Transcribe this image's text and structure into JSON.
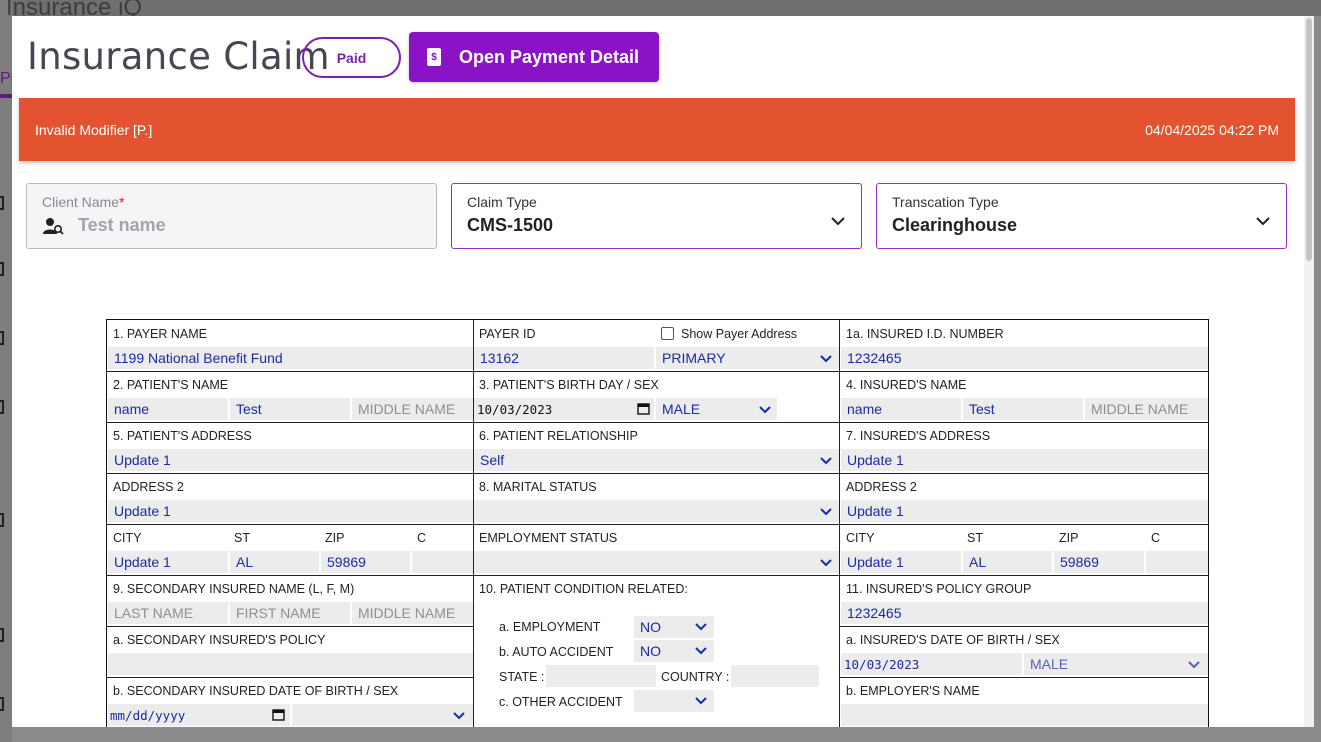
{
  "page": {
    "title": "Insurance Claim",
    "status_badge": "Paid",
    "open_payment_detail": "Open Payment Detail",
    "alert_message": "Invalid Modifier [P.]",
    "alert_timestamp": "04/04/2025 04:22 PM",
    "client_name_label": "Client Name",
    "client_name_required": "*",
    "client_name_placeholder": "Test name",
    "claim_type_label": "Claim Type",
    "claim_type_value": "CMS-1500",
    "transaction_type_label": "Transcation Type",
    "transaction_type_value": "Clearinghouse"
  },
  "form": {
    "payer_name_label": "1. PAYER NAME",
    "payer_name": "1199 National Benefit Fund",
    "payer_id_label": "PAYER ID",
    "payer_id": "13162",
    "show_payer_address": "Show Payer Address",
    "payer_priority": "PRIMARY",
    "insured_id_label": "1a. INSURED I.D. NUMBER",
    "insured_id": "1232465",
    "patient_name_label": "2. PATIENT'S NAME",
    "patient_first": "name",
    "patient_last": "Test",
    "middle_name_ph": "MIDDLE NAME",
    "birth_label": "3. PATIENT'S BIRTH DAY / SEX",
    "birth_date": "10/03/2023",
    "sex": "MALE",
    "insured_name_label": "4. INSURED'S NAME",
    "insured_first": "name",
    "insured_last": "Test",
    "patient_address_label": "5. PATIENT'S ADDRESS",
    "patient_address": "Update 1",
    "relationship_label": "6. PATIENT RELATIONSHIP",
    "relationship": "Self",
    "insured_address_label": "7. INSURED'S ADDRESS",
    "insured_address": "Update 1",
    "address2_label": "ADDRESS 2",
    "address2": "Update 1",
    "marital_label": "8. MARITAL STATUS",
    "city_label": "CITY",
    "st_label": "ST",
    "zip_label": "ZIP",
    "c_label": "C",
    "city": "Update 1",
    "st": "AL",
    "zip": "59869",
    "employment_status_label": "EMPLOYMENT STATUS",
    "secondary_name_label": "9. SECONDARY INSURED NAME (L, F, M)",
    "last_name_ph": "LAST NAME",
    "first_name_ph": "FIRST NAME",
    "condition_label": "10. PATIENT CONDITION RELATED:",
    "employment_label": "a. EMPLOYMENT",
    "employment_value": "NO",
    "auto_accident_label": "b. AUTO ACCIDENT",
    "auto_accident_value": "NO",
    "state_label": "STATE :",
    "country_label": "COUNTRY :",
    "other_accident_label": "c. OTHER ACCIDENT",
    "policy_group_label": "11. INSURED'S POLICY GROUP",
    "policy_group": "1232465",
    "secondary_policy_label": "a. SECONDARY INSURED'S POLICY",
    "insured_dob_label": "a. INSURED'S DATE OF BIRTH / SEX",
    "insured_dob": "10/03/2023",
    "insured_sex": "MALE",
    "secondary_dob_label": "b. SECONDARY INSURED DATE OF BIRTH / SEX",
    "date_placeholder": "mm/dd/yyyy",
    "employer_label": "b. EMPLOYER'S NAME"
  },
  "background": {
    "frag_top": "Insurance iQ",
    "frag_tab": "Pr"
  },
  "colors": {
    "accent": "#8a13c5",
    "alert": "#e4532f",
    "input_text": "#1b2aa6"
  }
}
